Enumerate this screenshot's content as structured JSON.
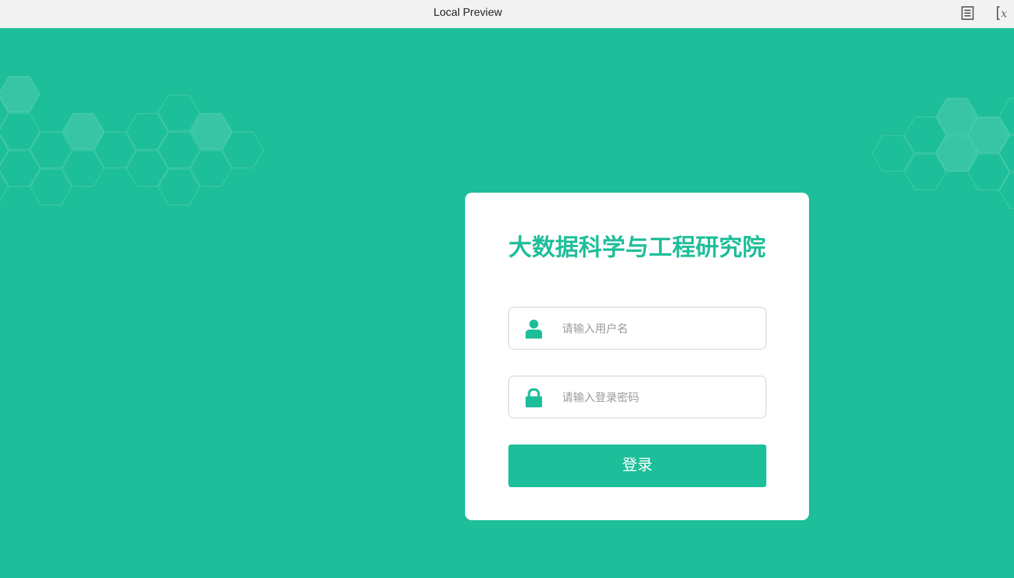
{
  "window": {
    "title": "Local Preview",
    "icons": [
      "document-list-icon",
      "variable-x-icon"
    ]
  },
  "colors": {
    "brand": "#1dbe9a",
    "card": "#ffffff",
    "titlebar": "#f2f2f2"
  },
  "login": {
    "title": "大数据科学与工程研究院",
    "username": {
      "value": "",
      "placeholder": "请输入用户名",
      "icon": "user-icon"
    },
    "password": {
      "value": "",
      "placeholder": "请输入登录密码",
      "icon": "lock-icon"
    },
    "submit_label": "登录"
  }
}
